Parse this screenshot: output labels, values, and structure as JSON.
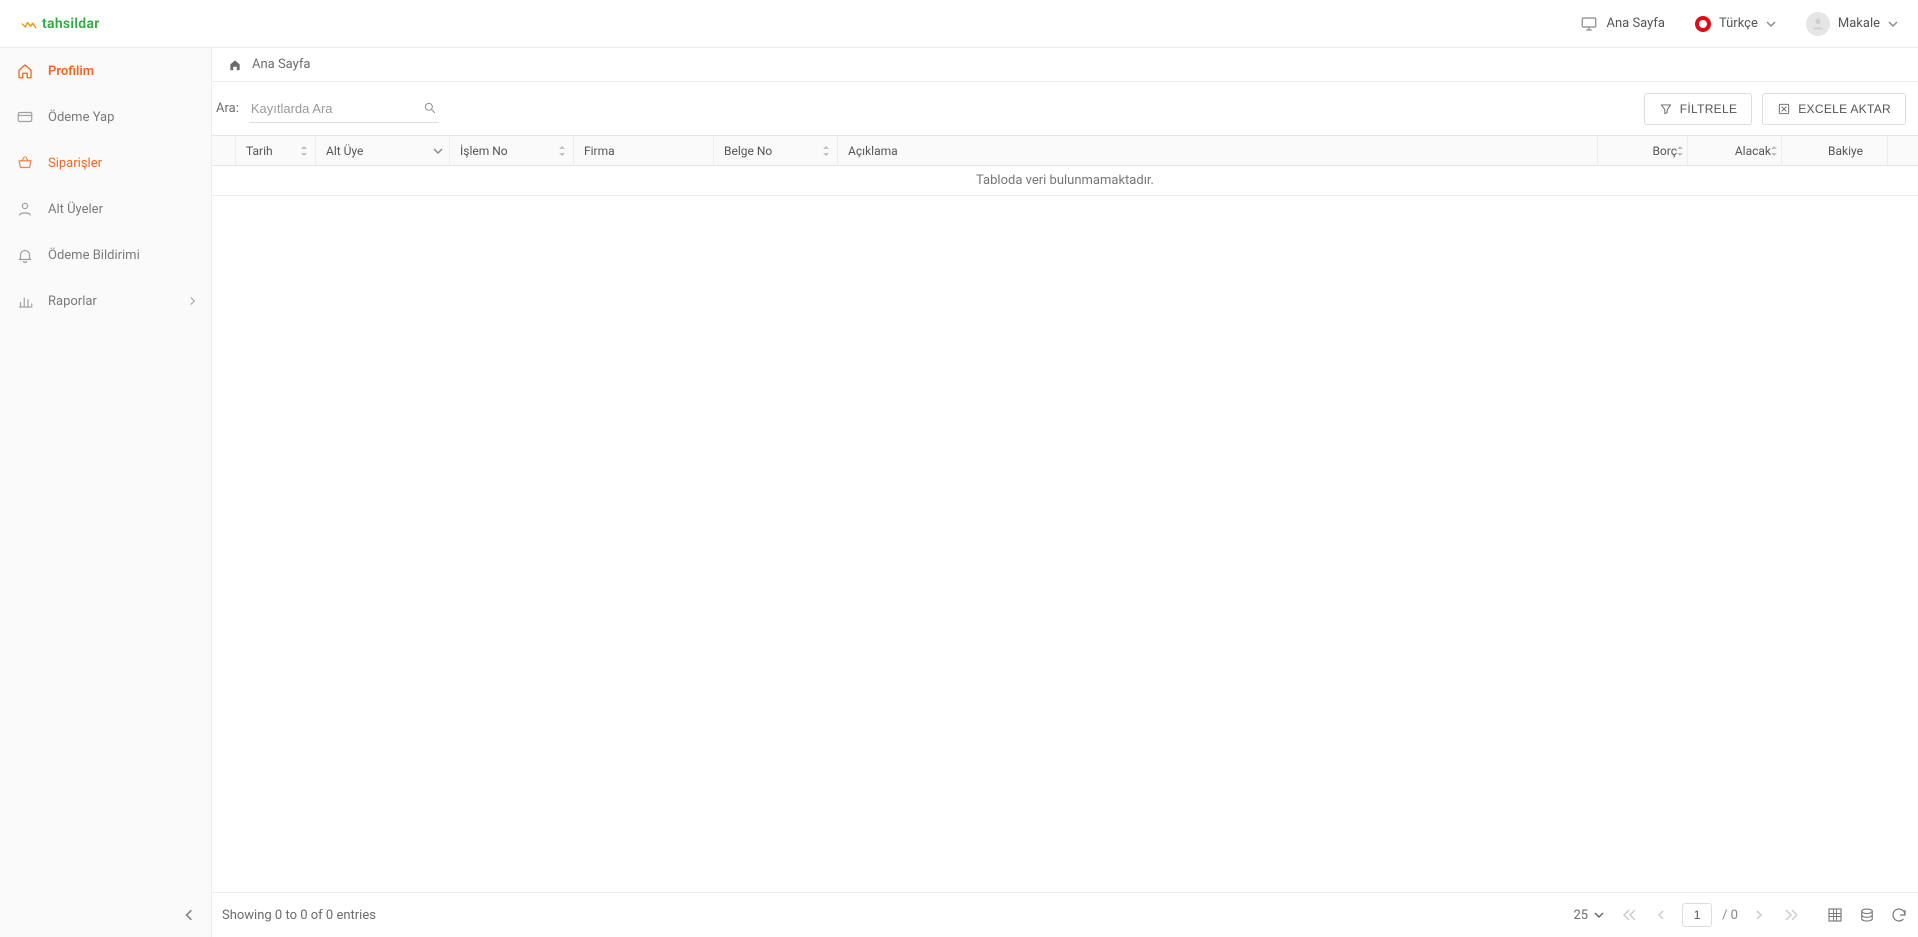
{
  "header": {
    "logo_text": "tahsildar",
    "home_label": "Ana Sayfa",
    "language_label": "Türkçe",
    "user_label": "Makale"
  },
  "sidebar": {
    "items": [
      {
        "label": "Profilim",
        "icon": "home-outline-icon",
        "active": true
      },
      {
        "label": "Ödeme Yap",
        "icon": "card-icon"
      },
      {
        "label": "Siparişler",
        "icon": "basket-icon",
        "accent": true
      },
      {
        "label": "Alt Üyeler",
        "icon": "user-icon"
      },
      {
        "label": "Ödeme Bildirimi",
        "icon": "bell-icon"
      },
      {
        "label": "Raporlar",
        "icon": "chart-icon",
        "has_children": true
      }
    ]
  },
  "breadcrumb": {
    "title": "Ana Sayfa"
  },
  "toolbar": {
    "search_label": "Ara:",
    "search_placeholder": "Kayıtlarda Ara",
    "filter_label": "FİLTRELE",
    "export_label": "EXCELE AKTAR"
  },
  "table": {
    "columns": {
      "tarih": "Tarih",
      "altuye": "Alt Üye",
      "islem": "İşlem No",
      "firma": "Firma",
      "belge": "Belge No",
      "aciklama": "Açıklama",
      "borc": "Borç",
      "alacak": "Alacak",
      "bakiye": "Bakiye"
    },
    "no_data": "Tabloda veri bulunmamaktadır."
  },
  "footer": {
    "showing": "Showing 0 to 0 of 0 entries",
    "page_size": "25",
    "page_current": "1",
    "page_total": "/ 0"
  }
}
